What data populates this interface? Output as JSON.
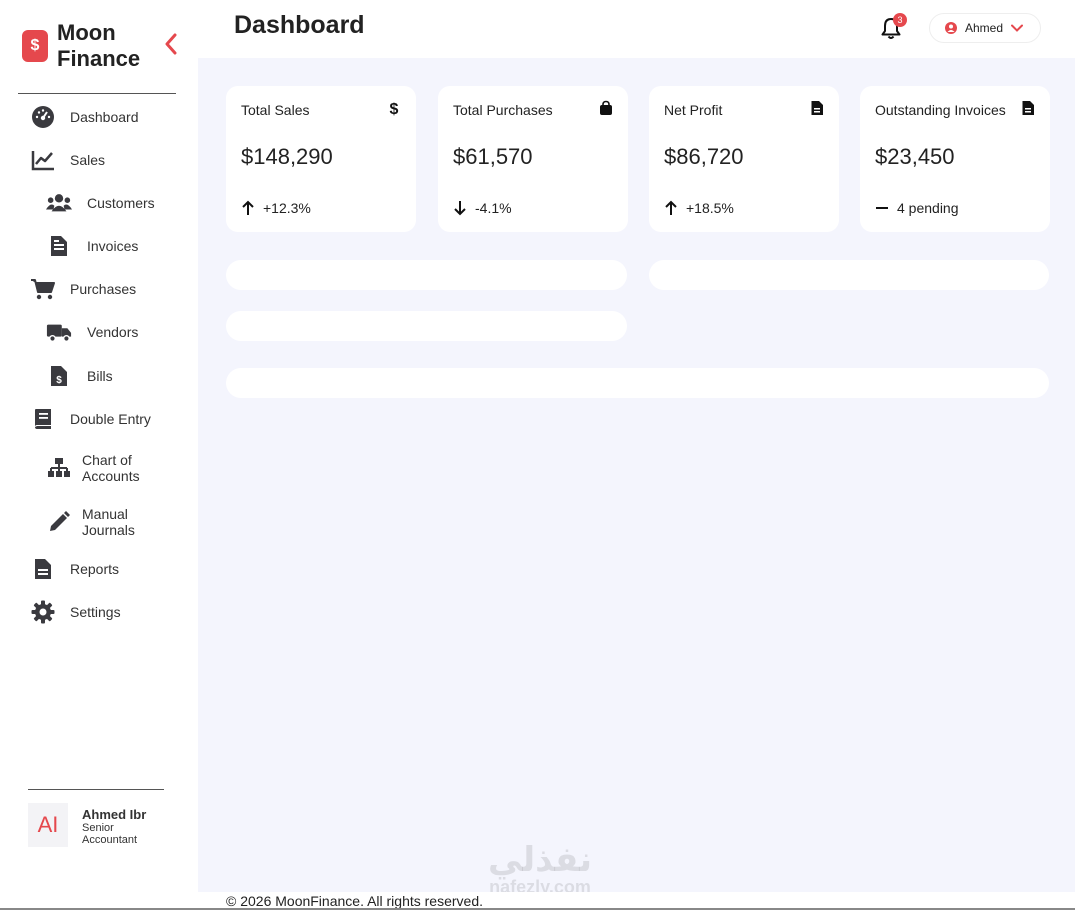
{
  "brand": {
    "name": "Moon Finance",
    "logo_glyph": "$"
  },
  "colors": {
    "accent": "#e5484d",
    "background": "#f4f5fd",
    "card": "#ffffff",
    "text": "#222222"
  },
  "sidebar": {
    "items": [
      {
        "label": "Dashboard",
        "icon": "dashboard-gauge-icon"
      },
      {
        "label": "Sales",
        "icon": "line-chart-icon"
      },
      {
        "label": "Customers",
        "icon": "users-icon"
      },
      {
        "label": "Invoices",
        "icon": "invoice-file-icon"
      },
      {
        "label": "Purchases",
        "icon": "cart-icon"
      },
      {
        "label": "Vendors",
        "icon": "truck-icon"
      },
      {
        "label": "Bills",
        "icon": "bill-file-icon"
      },
      {
        "label": "Double Entry",
        "icon": "book-icon"
      },
      {
        "label": "Chart of Accounts",
        "icon": "sitemap-icon"
      },
      {
        "label": "Manual Journals",
        "icon": "pencil-icon"
      },
      {
        "label": "Reports",
        "icon": "report-file-icon"
      },
      {
        "label": "Settings",
        "icon": "gear-icon"
      }
    ]
  },
  "user": {
    "initials": "AI",
    "name": "Ahmed Ibr",
    "role": "Senior Accountant"
  },
  "header": {
    "title": "Dashboard",
    "notification_count": "3",
    "user_menu_label": "Ahmed"
  },
  "cards": [
    {
      "title": "Total Sales",
      "value": "$148,290",
      "change": "+12.3%",
      "icon": "dollar-icon",
      "trend": "up"
    },
    {
      "title": "Total Purchases",
      "value": "$61,570",
      "change": "-4.1%",
      "icon": "shopping-bag-icon",
      "trend": "down"
    },
    {
      "title": "Net Profit",
      "value": "$86,720",
      "change": "+18.5%",
      "icon": "file-icon",
      "trend": "up"
    },
    {
      "title": "Outstanding Invoices",
      "value": "$23,450",
      "change": "4 pending",
      "icon": "file-icon",
      "trend": "flat"
    }
  ],
  "footer": {
    "text": "© 2026 MoonFinance. All rights reserved."
  },
  "watermark": {
    "arabic": "نفذلي",
    "latin": "nafezly.com"
  }
}
